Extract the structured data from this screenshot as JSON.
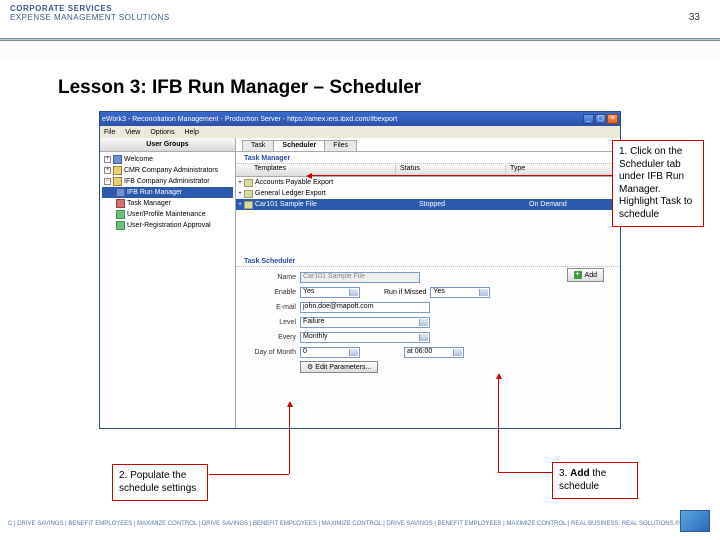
{
  "header": {
    "line1": "CORPORATE SERVICES",
    "line2": "EXPENSE MANAGEMENT SOLUTIONS",
    "page_number": "33"
  },
  "title": "Lesson 3: IFB Run Manager – Scheduler",
  "window": {
    "title": "eWork3 - Reconciliation Management - Production Server - https://amex.iers.ibxd.com/ifbexport",
    "menu": [
      "File",
      "View",
      "Options",
      "Help"
    ]
  },
  "sidebar": {
    "header": "User Groups",
    "items": [
      {
        "label": "Welcome",
        "exp": "+"
      },
      {
        "label": "CMR Company Administrators",
        "exp": "+"
      },
      {
        "label": "IFB Company Administrator",
        "exp": "−"
      },
      {
        "label": "IFB Run Manager",
        "sel": true
      },
      {
        "label": "Task Manager"
      },
      {
        "label": "User/Profile Maintenance"
      },
      {
        "label": "User-Registration Approval"
      }
    ]
  },
  "tabs": {
    "items": [
      "Task",
      "Scheduler",
      "Files"
    ],
    "active": 1
  },
  "task_manager": {
    "label": "Task Manager",
    "columns": {
      "templates": "Templates",
      "status": "Status",
      "type": "Type"
    },
    "rows": [
      {
        "name": "Accounts Payable Export",
        "status": "",
        "type": ""
      },
      {
        "name": "General Ledger Export",
        "status": "",
        "type": ""
      },
      {
        "name": "Car101 Sample File",
        "status": "Stopped",
        "type": "On Demand",
        "sel": true
      }
    ]
  },
  "task_scheduler": {
    "label": "Task Scheduler",
    "add_button": "Add",
    "fields": {
      "name": {
        "label": "Name",
        "value": "Car101 Sample File"
      },
      "enable": {
        "label": "Enable",
        "value": "Yes",
        "aux_label": "Run if Missed",
        "aux_value": "Yes"
      },
      "email": {
        "label": "E-mail",
        "value": "john.doe@mapoft.com"
      },
      "level": {
        "label": "Level",
        "value": "Failure"
      },
      "every": {
        "label": "Every",
        "value": "Monthly"
      },
      "day": {
        "label": "Day of Month",
        "value": "0",
        "time_value": "at 06:00"
      },
      "edit_params": "Edit Parameters..."
    }
  },
  "callouts": {
    "c1": "1. Click on the Scheduler tab under IFB Run Manager. Highlight Task to schedule",
    "c2": "2. Populate the schedule settings",
    "c3a": "3. ",
    "c3b": "Add",
    "c3c": " the schedule"
  },
  "footer": "C | DRIVE SAVINGS | BENEFIT EMPLOYEES | MAXIMIZE CONTROL | DRIVE SAVINGS | BENEFIT EMPLOYEES | MAXIMIZE CONTROL | DRIVE SAVINGS | BENEFIT EMPLOYEES | MAXIMIZE CONTROL | REAL BUSINESS. REAL SOLUTIONS.®"
}
